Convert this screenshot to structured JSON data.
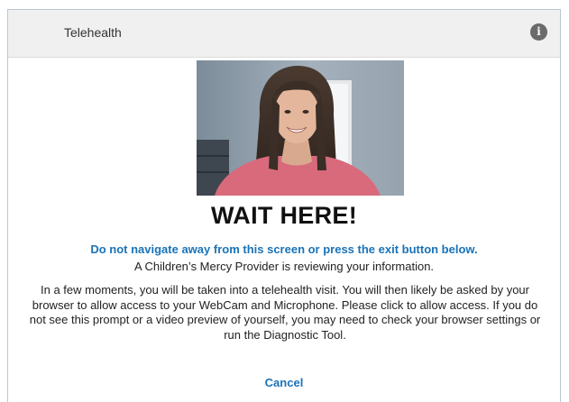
{
  "header": {
    "title": "Telehealth",
    "info_icon": "info-icon",
    "info_glyph": "i"
  },
  "video_preview": {
    "content": "webcam-self-preview"
  },
  "main": {
    "heading": "WAIT HERE!",
    "warning": "Do not navigate away from this screen or press the exit button below.",
    "reviewing": "A Children’s Mercy Provider is reviewing your information.",
    "instructions": "In a few moments, you will be taken into a telehealth visit.  You will then likely be asked by your browser to allow access to your WebCam and Microphone.  Please click to allow access.  If you do not see this prompt or a video preview of yourself, you may need to check your browser settings or run the Diagnostic Tool.",
    "cancel_label": "Cancel"
  },
  "colors": {
    "link_blue": "#1a73b8",
    "header_bg": "#f0f0f0",
    "frame_border": "#b9c6d6"
  }
}
